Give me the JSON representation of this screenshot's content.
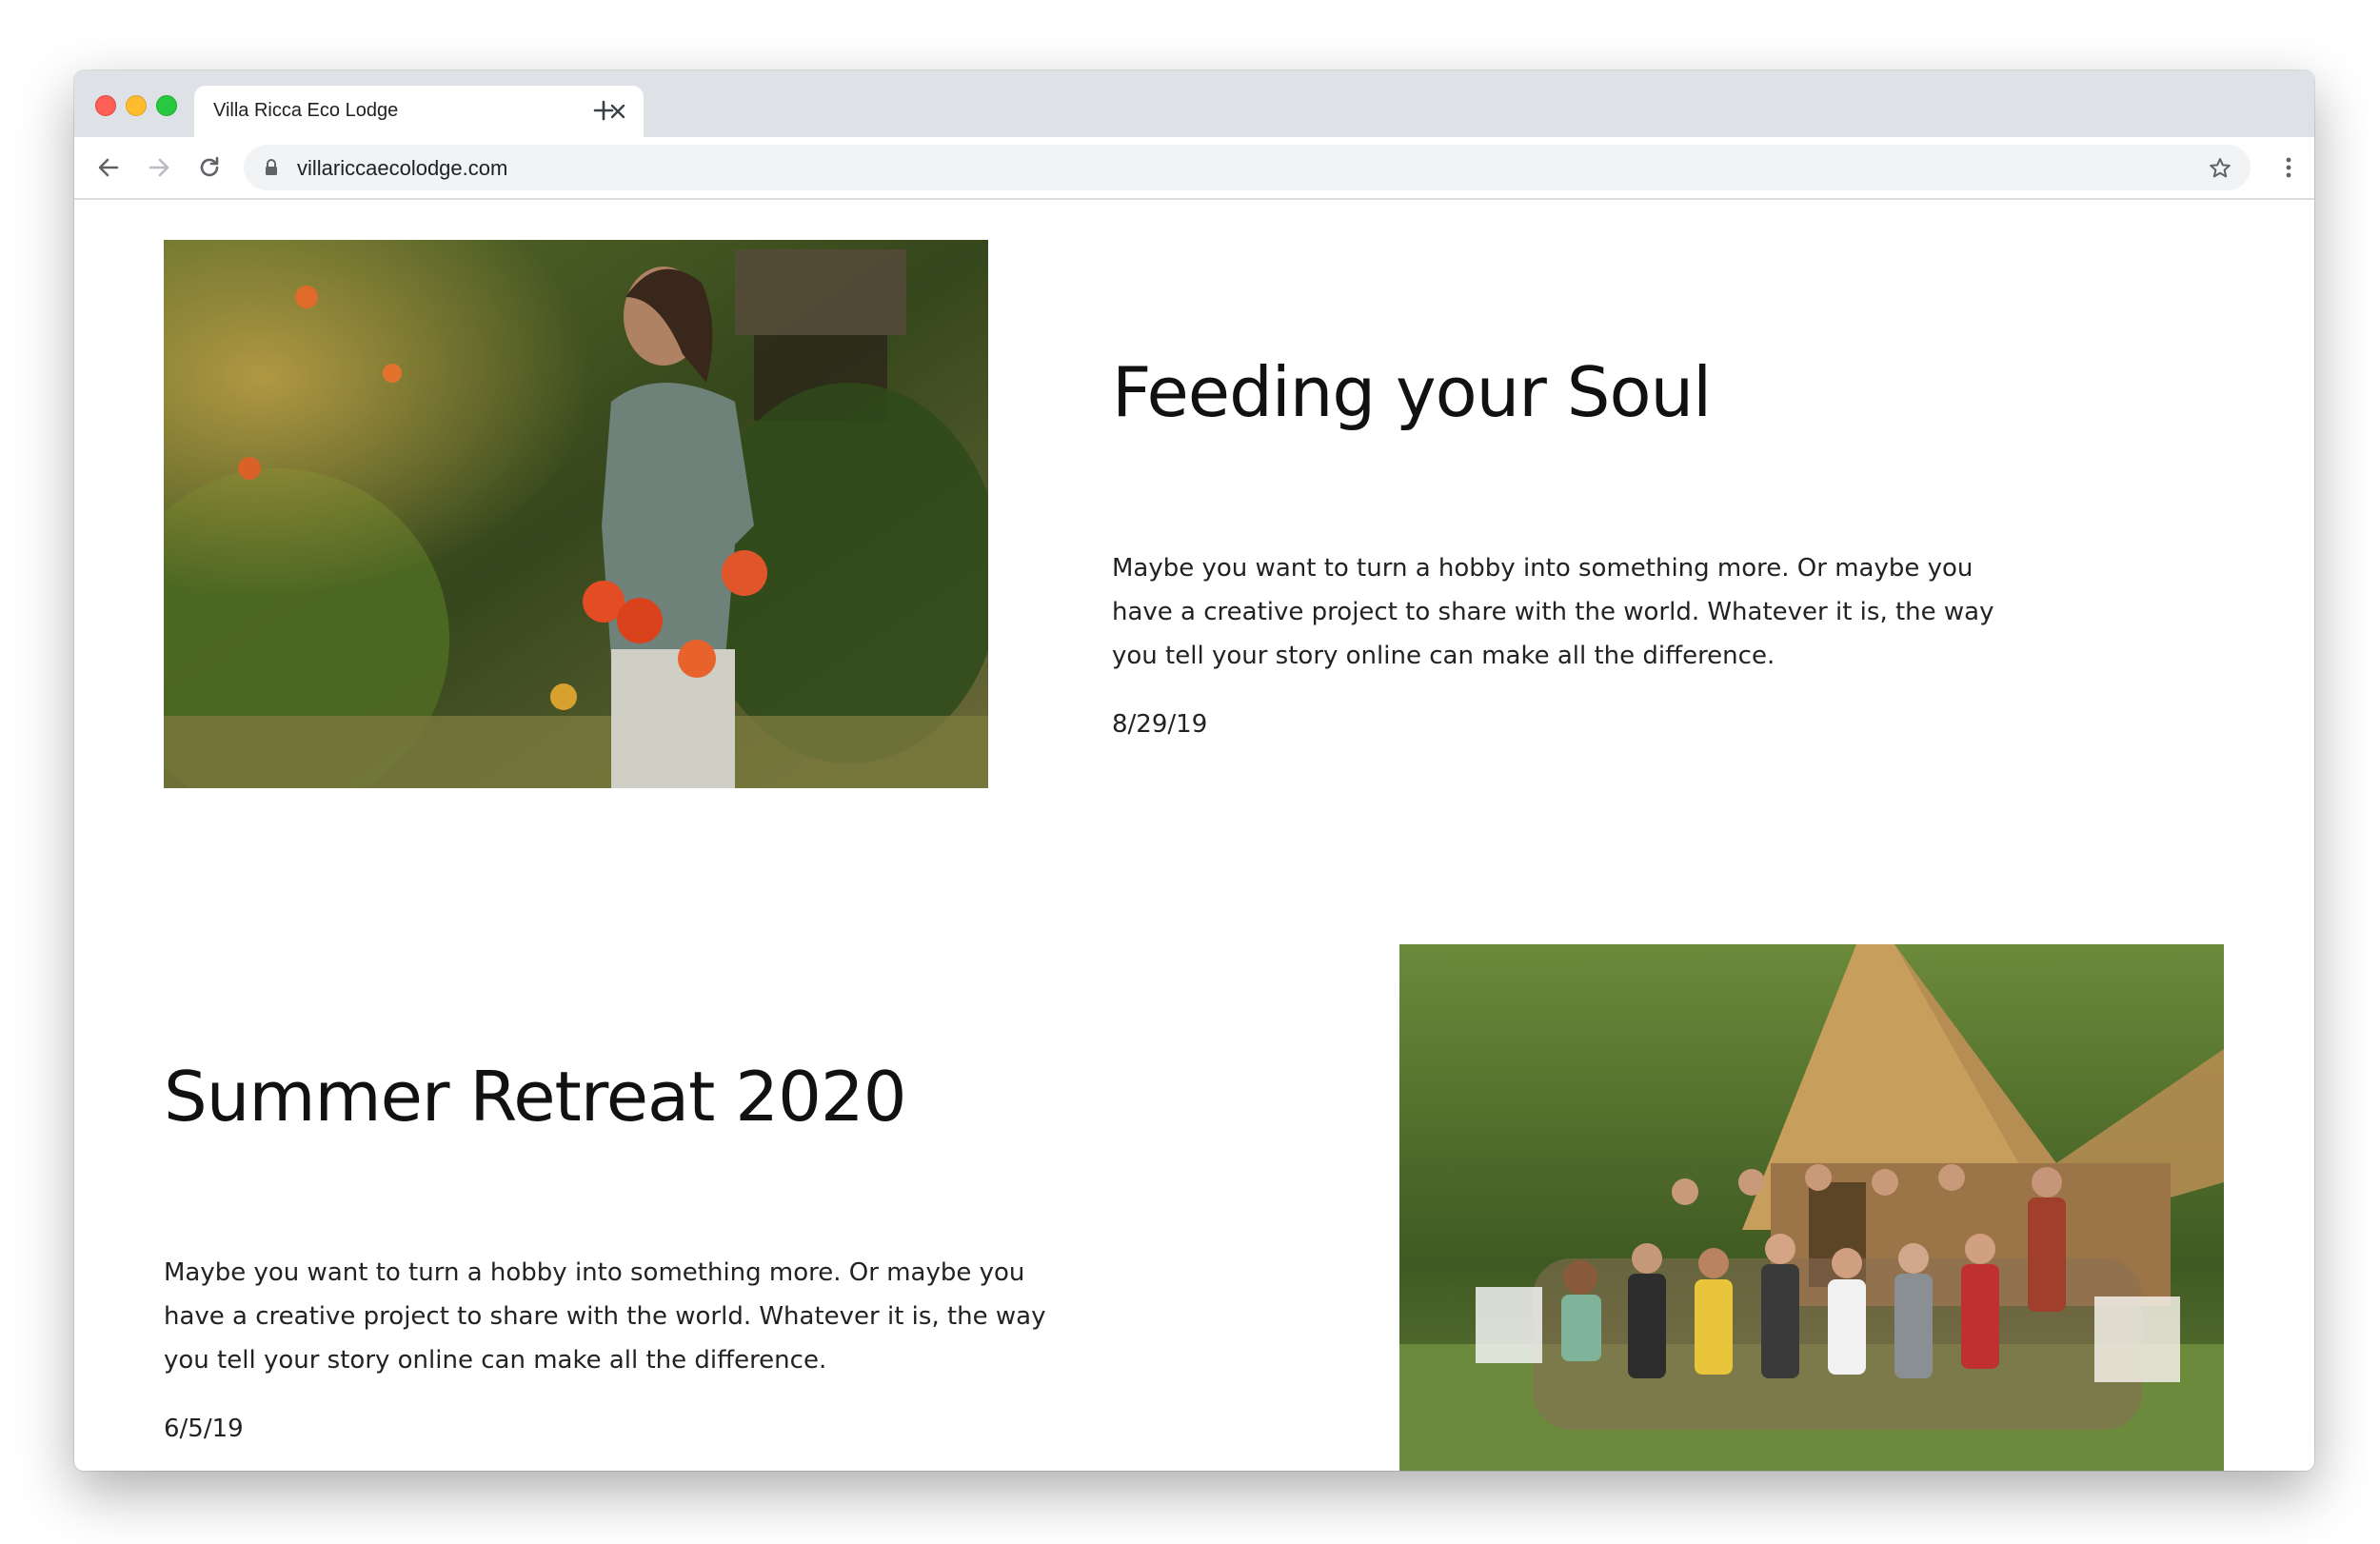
{
  "browser": {
    "tab": {
      "title": "Villa Ricca Eco Lodge"
    },
    "address_bar": {
      "url": "villariccaecolodge.com"
    },
    "icons": [
      "close-icon",
      "plus-icon",
      "arrow-left-icon",
      "arrow-right-icon",
      "reload-icon",
      "lock-icon",
      "star-icon",
      "kebab-menu-icon"
    ]
  },
  "posts": [
    {
      "title": "Feeding your Soul",
      "excerpt": "Maybe you want to turn a hobby into something more. Or maybe you have a creative project to share with the world. Whatever it is, the way you tell your story online can make all the difference.",
      "date": "8/29/19"
    },
    {
      "title": "Summer Retreat 2020",
      "excerpt": "Maybe you want to turn a hobby into something more. Or maybe you have a creative project to share with the world. Whatever it is, the way you tell your story online can make all the difference.",
      "date": "6/5/19"
    }
  ],
  "colors": {
    "tabstrip_bg": "#dee1e6",
    "omnibox_bg": "#f1f3f4",
    "title_text": "#111111",
    "body_text": "#222222"
  }
}
